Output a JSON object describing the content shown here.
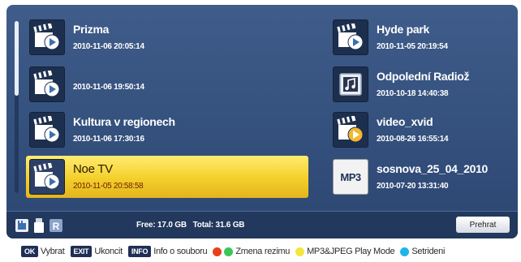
{
  "files_left": [
    {
      "name": "Prizma",
      "date": "2010-11-06 20:05:14",
      "icon": "video-file-icon"
    },
    {
      "name": "",
      "date": "2010-11-06 19:50:14",
      "icon": "video-file-icon"
    },
    {
      "name": "Kultura v regionech",
      "date": "2010-11-06 17:30:16",
      "icon": "video-file-icon"
    },
    {
      "name": "Noe TV",
      "date": "2010-11-05 20:58:58",
      "icon": "video-file-icon",
      "selected": true
    }
  ],
  "files_right": [
    {
      "name": "Hyde park",
      "date": "2010-11-05 20:19:54",
      "icon": "video-file-icon"
    },
    {
      "name": "Odpolední Radiož",
      "date": "2010-10-18 14:40:38",
      "icon": "music-file-icon"
    },
    {
      "name": "video_xvid",
      "date": "2010-08-26 16:55:14",
      "icon": "video-file-icon"
    },
    {
      "name": "sosnova_25_04_2010",
      "date": "2010-07-20 13:31:40",
      "icon": "mp3-file-icon",
      "icon_text": "MP3"
    }
  ],
  "status": {
    "free_label": "Free: 17.0 GB",
    "total_label": "Total: 31.6 GB",
    "play_button": "Prehrat"
  },
  "help": {
    "ok_key": "OK",
    "ok_label": "Vybrat",
    "exit_key": "EXIT",
    "exit_label": "Ukoncit",
    "info_key": "INFO",
    "info_label": "Info o souboru",
    "mode_label": "Zmena rezimu",
    "yellow_label": "MP3&JPEG Play Mode",
    "blue_label": "Setrideni"
  },
  "colors": {
    "red": "#e8401c",
    "green": "#38c85a",
    "yellow": "#f5e63c",
    "blue": "#1fb5e8",
    "selection": "#f3cf2a",
    "panel": "#3f5c8a"
  }
}
